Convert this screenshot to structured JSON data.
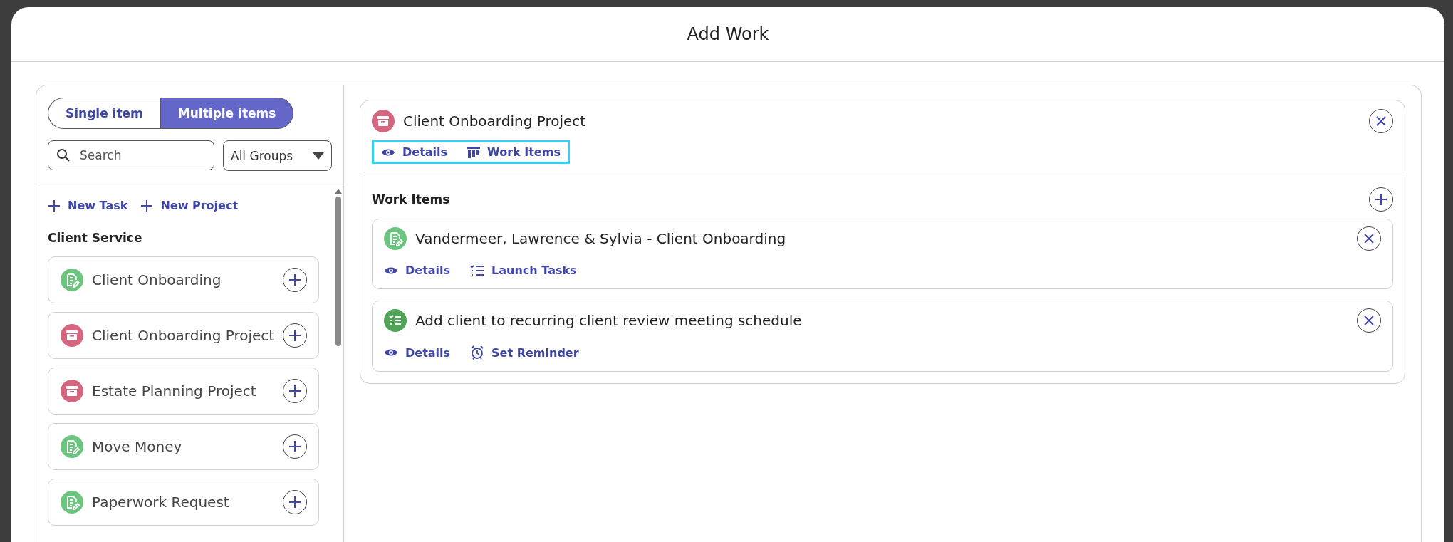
{
  "dialog": {
    "title": "Add Work"
  },
  "mode_toggle": [
    {
      "label": "Single item",
      "selected": false
    },
    {
      "label": "Multiple items",
      "selected": true
    }
  ],
  "search": {
    "placeholder": "Search"
  },
  "group_filter": {
    "value": "All Groups"
  },
  "create_links": [
    {
      "label": "New Task"
    },
    {
      "label": "New Project"
    }
  ],
  "section": {
    "title": "Client Service",
    "items": [
      {
        "label": "Client Onboarding",
        "kind": "task"
      },
      {
        "label": "Client Onboarding Project",
        "kind": "project"
      },
      {
        "label": "Estate Planning Project",
        "kind": "project"
      },
      {
        "label": "Move Money",
        "kind": "task"
      },
      {
        "label": "Paperwork Request",
        "kind": "task"
      }
    ]
  },
  "project": {
    "title": "Client Onboarding Project",
    "kind": "project",
    "actions_highlighted": true,
    "actions": [
      {
        "label": "Details",
        "kind": "details"
      },
      {
        "label": "Work Items",
        "kind": "columns"
      }
    ],
    "work_items_title": "Work Items",
    "work_items": [
      {
        "title": "Vandermeer, Lawrence & Sylvia - Client Onboarding",
        "kind": "task",
        "actions": [
          {
            "label": "Details",
            "kind": "details"
          },
          {
            "label": "Launch Tasks",
            "kind": "launch"
          }
        ]
      },
      {
        "title": "Add client to recurring client review meeting schedule",
        "kind": "checklist",
        "actions": [
          {
            "label": "Details",
            "kind": "details"
          },
          {
            "label": "Set Reminder",
            "kind": "reminder"
          }
        ]
      }
    ]
  }
}
